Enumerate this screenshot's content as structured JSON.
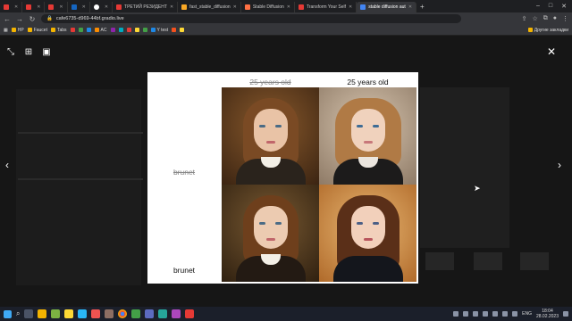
{
  "tabs": [
    {
      "label": "",
      "color": "#e53935"
    },
    {
      "label": "",
      "color": "#e53935"
    },
    {
      "label": "",
      "color": "#e53935"
    },
    {
      "label": "",
      "color": "#1565c0"
    },
    {
      "label": "",
      "color": "#ffffff"
    },
    {
      "label": "ТРЕТИЙ РЕЗИДЕНТ",
      "color": "#e53935"
    },
    {
      "label": "fast_stable_diffusion",
      "color": "#f9a825"
    },
    {
      "label": "Stable Diffusion",
      "color": "#ff7043"
    },
    {
      "label": "Transform Your Self",
      "color": "#e53935"
    },
    {
      "label": "stable diffusion aut",
      "color": "#4285f4",
      "active": true
    }
  ],
  "address": {
    "url": "cafe6735-d969-44bf.gradio.live"
  },
  "bookmarks": [
    "HP",
    "Faucet",
    "Tabs",
    "AC",
    "Y test",
    "Другие закладки"
  ],
  "viewer": {
    "columns": [
      "25 years old",
      "25 years old"
    ],
    "rows": [
      "brunet",
      "brunet"
    ]
  },
  "taskbar": {
    "language": "ENG",
    "time": "18:04",
    "date": "28.02.2023"
  },
  "colors": {
    "accent": "#4285f4",
    "page_bg": "#161616"
  }
}
